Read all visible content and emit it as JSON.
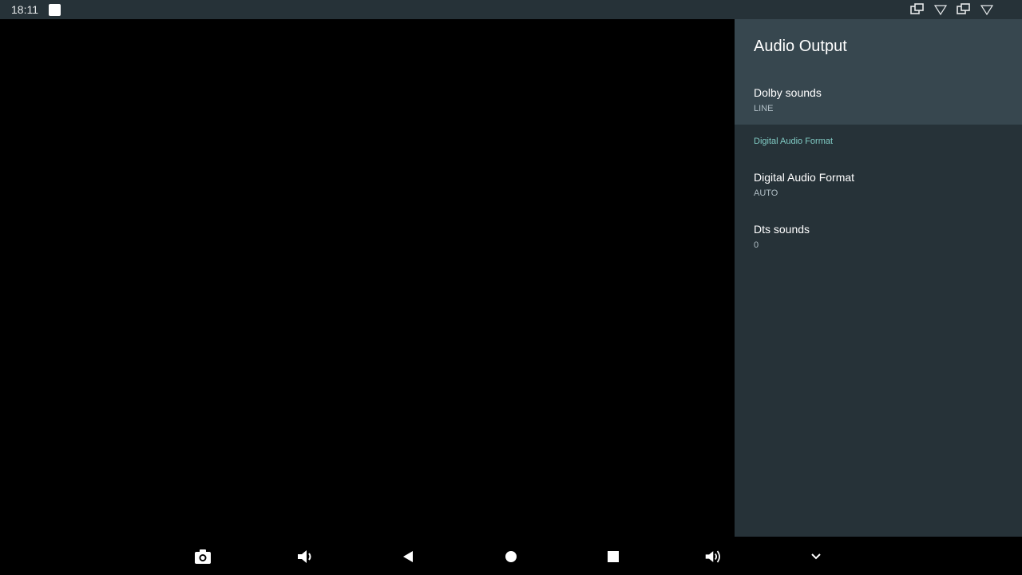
{
  "status_bar": {
    "time": "18:11",
    "icons": [
      "notification-square-icon",
      "cast-icon",
      "wifi-icon",
      "cast-icon",
      "wifi-icon"
    ]
  },
  "panel": {
    "title": "Audio Output",
    "items": [
      {
        "title": "Dolby sounds",
        "summary": "LINE",
        "focused": true
      },
      {
        "category": "Digital Audio Format"
      },
      {
        "title": "Digital Audio Format",
        "summary": "AUTO"
      },
      {
        "title": "Dts sounds",
        "summary": "0"
      }
    ]
  },
  "nav_bar": {
    "buttons": [
      "camera-icon",
      "volume-down-icon",
      "back-icon",
      "home-icon",
      "recents-icon",
      "volume-up-icon",
      "collapse-icon"
    ]
  },
  "colors": {
    "panel_bg": "#263238",
    "header_bg": "#37474f",
    "accent": "#80cbc4"
  }
}
